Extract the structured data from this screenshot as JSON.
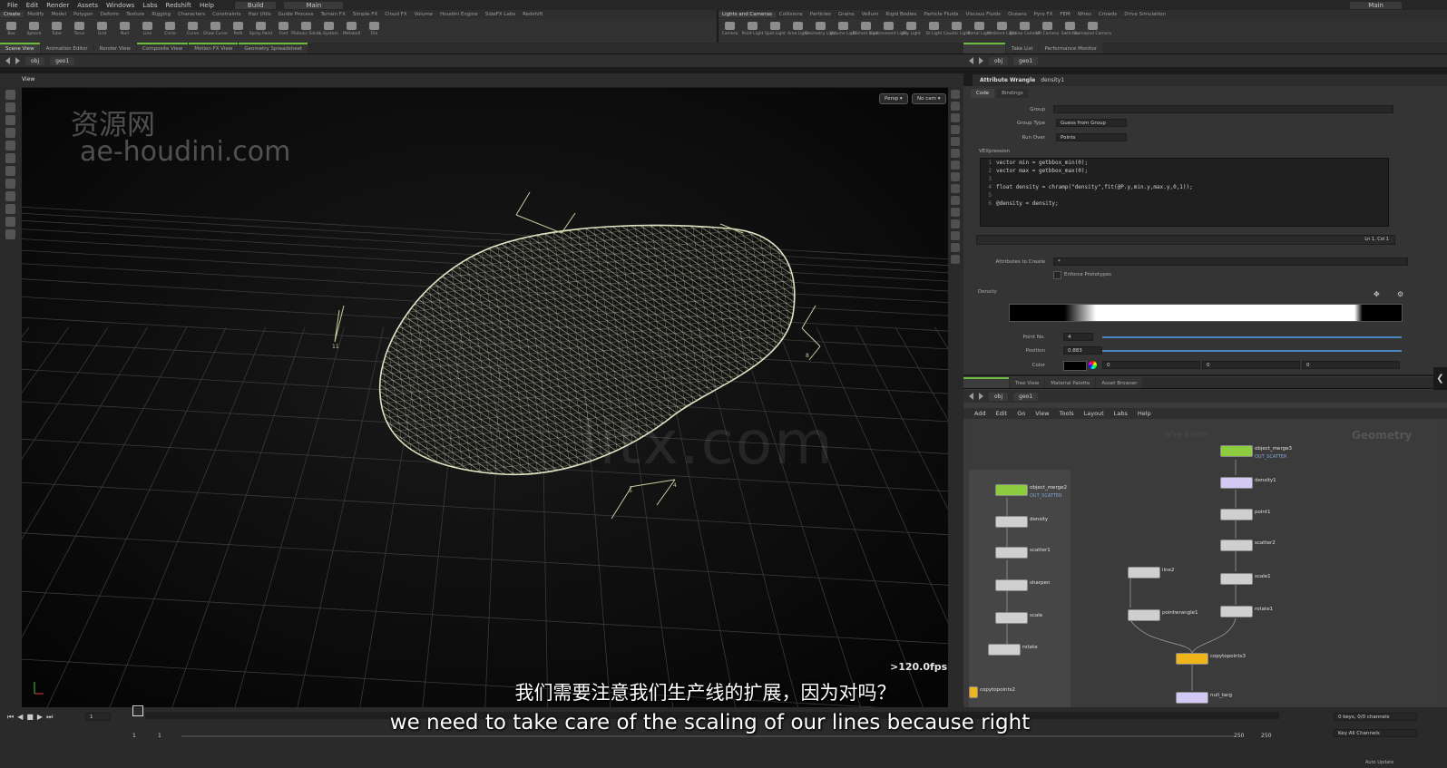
{
  "menubar": {
    "items": [
      "File",
      "Edit",
      "Render",
      "Assets",
      "Windows",
      "Labs",
      "Redshift",
      "Help"
    ],
    "build": "Build",
    "desktop": "Main",
    "desktop_right": "Main"
  },
  "shelf_tabs_left": [
    "Create",
    "Modify",
    "Model",
    "Polygon",
    "Deform",
    "Texture",
    "Rigging",
    "Characters",
    "Constraints",
    "Hair Utils",
    "Guide Process",
    "Terrain FX",
    "Simple FX",
    "Cloud FX",
    "Volume",
    "Houdini Engine",
    "SideFX Labs",
    "Redshift"
  ],
  "shelf_tabs_right": [
    "Lights and Cameras",
    "Collisions",
    "Particles",
    "Grains",
    "Vellum",
    "Rigid Bodies",
    "Particle Fluids",
    "Viscous Fluids",
    "Oceans",
    "Pyro FX",
    "FEM",
    "Wires",
    "Crowds",
    "Drive Simulation"
  ],
  "shelf_tools_left": [
    "Box",
    "Sphere",
    "Tube",
    "Torus",
    "Grid",
    "Null",
    "Line",
    "Circle",
    "Curve",
    "Draw Curve",
    "Path",
    "Spray Paint",
    "Font",
    "Platonic Solids",
    "L-System",
    "Metaball",
    "File"
  ],
  "shelf_tools_right": [
    "Camera",
    "Point Light",
    "Spot Light",
    "Area Light",
    "Geometry Light",
    "Volume Light",
    "Distant Light",
    "Environment Light",
    "Sky Light",
    "GI Light",
    "Caustic Light",
    "Portal Light",
    "Ambient Light",
    "Stereo Camera",
    "VR Camera",
    "Switcher",
    "Gamepad Camera"
  ],
  "left_pane_tabs": [
    "Scene View",
    "Animation Editor",
    "Render View",
    "Composite View",
    "Motion FX View",
    "Geometry Spreadsheet"
  ],
  "right_top_tabs": [
    "Take List",
    "Performance Monitor"
  ],
  "path": {
    "root": "obj",
    "node": "geo1"
  },
  "viewport": {
    "label": "View",
    "persp": "Persp ▾",
    "cam": "No cam ▾",
    "fps": ">120.0fps",
    "watermark_cn": "资源网",
    "watermark_url": "ae-houdini.com",
    "watermark_center": "litx.com",
    "markers": [
      "11",
      "8",
      "5",
      "4"
    ]
  },
  "params": {
    "node_type": "Attribute Wrangle",
    "node_name": "density1",
    "tabs": [
      "Code",
      "Bindings"
    ],
    "group_label": "Group",
    "group_value": "",
    "group_type_label": "Group Type",
    "group_type_value": "Guess from Group",
    "run_over_label": "Run Over",
    "run_over_value": "Points",
    "vex_label": "VEXpression",
    "code_lines": [
      "vector min = getbbox_min(0);",
      "vector max = getbbox_max(0);",
      "",
      "float density = chramp(\"density\",fit(@P.y,min.y,max.y,0,1));",
      "",
      "@density = density;"
    ],
    "cursor_pos": "Ln 1, Col 1",
    "attributes_to_create_label": "Attributes to Create",
    "attributes_to_create_value": "*",
    "enforce_prototypes": "Enforce Prototypes",
    "density_label": "Density",
    "point_no_label": "Point No.",
    "point_no_value": "4",
    "position_label": "Position",
    "position_value": "0.883",
    "color_label": "Color",
    "color_r": "0",
    "color_g": "0",
    "color_b": "0"
  },
  "network": {
    "tabs": [
      "Tree View",
      "Material Palette",
      "Asset Browser"
    ],
    "menu": [
      "Add",
      "Edit",
      "Go",
      "View",
      "Tools",
      "Layout",
      "Labs",
      "Help"
    ],
    "context_label": "Geometry",
    "ghost_label": "Wire Editor",
    "nodes": [
      {
        "name": "object_merge3",
        "sub": "OUT_SCATTER"
      },
      {
        "name": "density1",
        "sub": ""
      },
      {
        "name": "point1",
        "sub": ""
      },
      {
        "name": "scatter2",
        "sub": ""
      },
      {
        "name": "line2",
        "sub": ""
      },
      {
        "name": "scale1",
        "sub": ""
      },
      {
        "name": "pointwrangle1",
        "sub": ""
      },
      {
        "name": "rotate1",
        "sub": ""
      },
      {
        "name": "copytopoints3",
        "sub": ""
      },
      {
        "name": "null_targ",
        "sub": ""
      },
      {
        "name": "object_merge2",
        "sub": "OUT_SCATTER"
      },
      {
        "name": "density",
        "sub": ""
      },
      {
        "name": "scatter1",
        "sub": ""
      },
      {
        "name": "sharpen",
        "sub": ""
      },
      {
        "name": "scale",
        "sub": ""
      },
      {
        "name": "rotate",
        "sub": ""
      },
      {
        "name": "copytopoints2",
        "sub": ""
      }
    ]
  },
  "timeline": {
    "frame": "1",
    "start": "1",
    "start2": "1",
    "end": "250",
    "end2": "250",
    "keys_label": "0 keys, 0/0 channels",
    "key_all": "Key All Channels",
    "auto_update": "Auto Update"
  },
  "subtitles": {
    "cn": "我们需要注意我们生产线的扩展，因为对吗？",
    "en": "we need to take care of the scaling of our lines because right"
  },
  "colors": {
    "accent_green": "#8ecc3f",
    "node_yellow": "#f0b51a",
    "wire": "#c8cda0",
    "grid": "#3a3a3a"
  }
}
